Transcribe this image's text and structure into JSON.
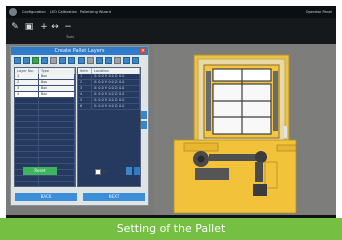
{
  "window": {
    "tabs": [
      "Configuration",
      "LEO Calibration",
      "Palletizing Wizard"
    ],
    "right_text": "Operator Panel"
  },
  "toolbar": {
    "labels": [
      "",
      "",
      "",
      ""
    ],
    "group_label": "Tools"
  },
  "dialog": {
    "title": "Create Pallet Layers",
    "left_grid": {
      "headers": [
        "Layer No.",
        "Type"
      ],
      "rows": [
        {
          "no": "1",
          "type": "Box",
          "state": "light"
        },
        {
          "no": "2",
          "type": "Box",
          "state": "light"
        },
        {
          "no": "3",
          "type": "Box",
          "state": "light"
        },
        {
          "no": "4",
          "type": "Box",
          "state": "sel"
        }
      ]
    },
    "right_grid": {
      "headers": [
        "Item",
        "Location"
      ],
      "rows": [
        {
          "item": "1",
          "loc": "X: 0.0  Y: 0.0  Z: 0.0"
        },
        {
          "item": "2",
          "loc": "X: 0.0  Y: 0.0  Z: 0.0"
        },
        {
          "item": "3",
          "loc": "X: 0.0  Y: 0.0  Z: 0.0"
        },
        {
          "item": "4",
          "loc": "X: 0.0  Y: 0.0  Z: 0.0"
        },
        {
          "item": "5",
          "loc": "X: 0.0  Y: 0.0  Z: 0.0"
        },
        {
          "item": "6",
          "loc": "X: 0.0  Y: 0.0  Z: 0.0"
        }
      ]
    },
    "reset_label": "Reset",
    "map_label": "Map",
    "back_label": "BACK",
    "next_label": "NEXT"
  },
  "caption": "Setting of the Pallet",
  "colors": {
    "caption_bg": "#75c043",
    "dialog_title": "#2f7bc9",
    "grid_dark": "#26395f",
    "pallet_yellow": "#f4c542",
    "robot_yellow": "#f1c23a"
  }
}
